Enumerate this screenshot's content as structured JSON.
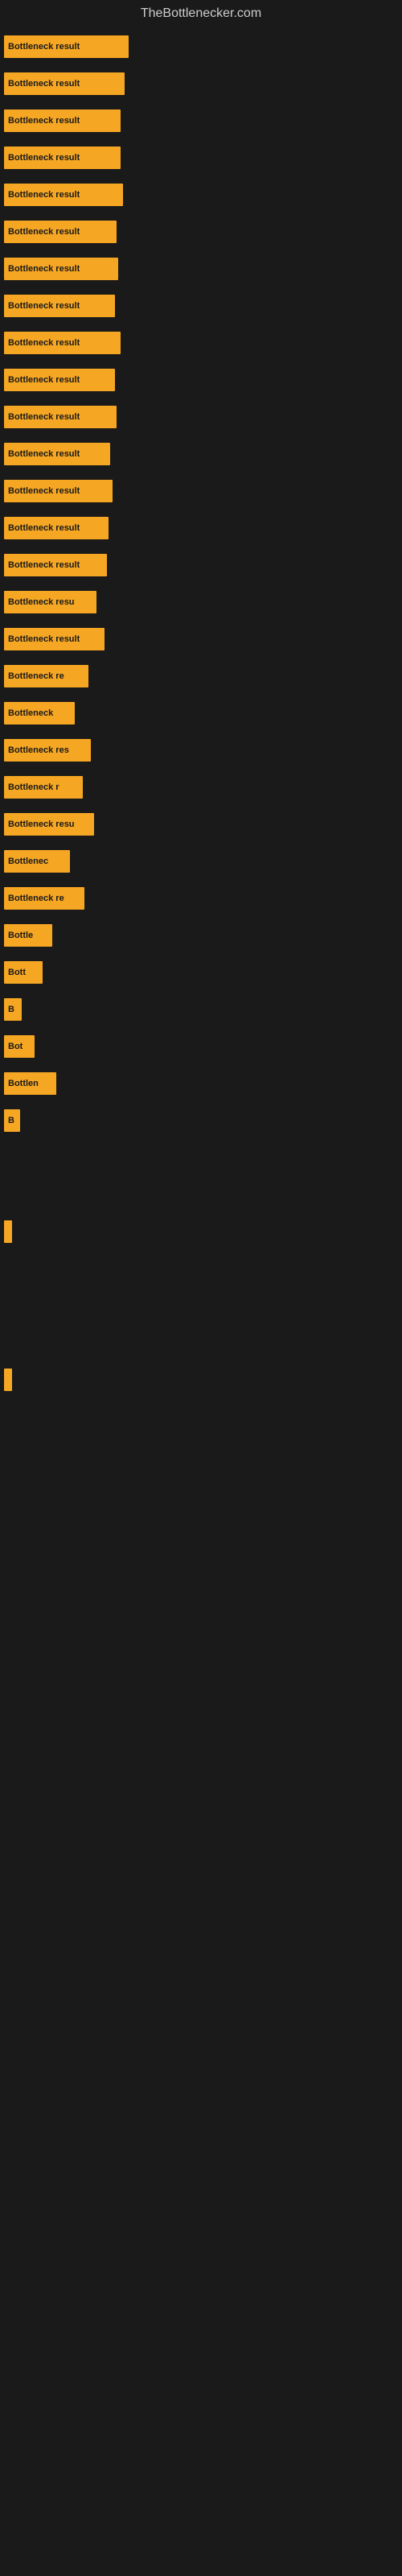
{
  "site": {
    "title": "TheBottlenecker.com"
  },
  "bars": [
    {
      "label": "Bottleneck result",
      "width": 155
    },
    {
      "label": "Bottleneck result",
      "width": 150
    },
    {
      "label": "Bottleneck result",
      "width": 145
    },
    {
      "label": "Bottleneck result",
      "width": 145
    },
    {
      "label": "Bottleneck result",
      "width": 148
    },
    {
      "label": "Bottleneck result",
      "width": 140
    },
    {
      "label": "Bottleneck result",
      "width": 142
    },
    {
      "label": "Bottleneck result",
      "width": 138
    },
    {
      "label": "Bottleneck result",
      "width": 145
    },
    {
      "label": "Bottleneck result",
      "width": 138
    },
    {
      "label": "Bottleneck result",
      "width": 140
    },
    {
      "label": "Bottleneck result",
      "width": 132
    },
    {
      "label": "Bottleneck result",
      "width": 135
    },
    {
      "label": "Bottleneck result",
      "width": 130
    },
    {
      "label": "Bottleneck result",
      "width": 128
    },
    {
      "label": "Bottleneck resu",
      "width": 115
    },
    {
      "label": "Bottleneck result",
      "width": 125
    },
    {
      "label": "Bottleneck re",
      "width": 105
    },
    {
      "label": "Bottleneck",
      "width": 88
    },
    {
      "label": "Bottleneck res",
      "width": 108
    },
    {
      "label": "Bottleneck r",
      "width": 98
    },
    {
      "label": "Bottleneck resu",
      "width": 112
    },
    {
      "label": "Bottlenec",
      "width": 82
    },
    {
      "label": "Bottleneck re",
      "width": 100
    },
    {
      "label": "Bottle",
      "width": 60
    },
    {
      "label": "Bott",
      "width": 48
    },
    {
      "label": "B",
      "width": 22
    },
    {
      "label": "Bot",
      "width": 38
    },
    {
      "label": "Bottlen",
      "width": 65
    },
    {
      "label": "B",
      "width": 20
    },
    {
      "label": "",
      "width": 0
    },
    {
      "label": "",
      "width": 0
    },
    {
      "label": "|",
      "width": 10
    },
    {
      "label": "",
      "width": 0
    },
    {
      "label": "",
      "width": 0
    },
    {
      "label": "",
      "width": 0
    },
    {
      "label": "",
      "width": 8
    }
  ]
}
